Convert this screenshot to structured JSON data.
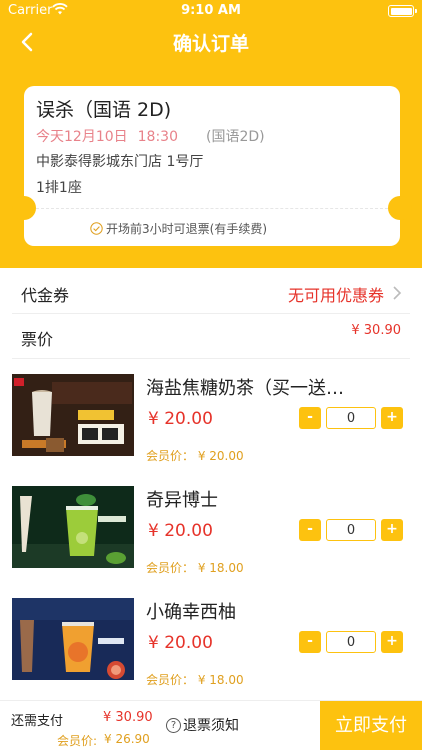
{
  "status_bar": {
    "carrier": "Carrier",
    "time": "9:10 AM"
  },
  "nav": {
    "title": "确认订单"
  },
  "ticket": {
    "movie": "误杀（国语 2D)",
    "date": "今天12月10日",
    "time": "18:30",
    "format": "(国语2D)",
    "cinema": "中影泰得影城东门店 1号厅",
    "seat": "1排1座",
    "refund_note": "开场前3小时可退票(有手续费)"
  },
  "voucher": {
    "label": "代金券",
    "status": "无可用优惠券"
  },
  "ticket_price": {
    "label": "票价",
    "value": "¥ 30.90"
  },
  "products": [
    {
      "name": "海盐焦糖奶茶（买一送一）",
      "price": "¥ 20.00",
      "member_price": "会员价： ¥ 20.00",
      "quantity": "0"
    },
    {
      "name": "奇异博士",
      "price": "¥ 20.00",
      "member_price": "会员价： ¥ 18.00",
      "quantity": "0"
    },
    {
      "name": "小确幸西柚",
      "price": "¥ 20.00",
      "member_price": "会员价： ¥ 18.00",
      "quantity": "0"
    }
  ],
  "stepper": {
    "minus": "-",
    "plus": "+"
  },
  "footer": {
    "due_label": "还需支付",
    "due_value": "¥ 30.90",
    "member_label": "会员价:",
    "member_value": "¥ 26.90",
    "notice_icon": "?",
    "notice": "退票须知",
    "pay_button": "立即支付"
  },
  "colors": {
    "accent": "#FDC20F",
    "price_red": "#E6332A",
    "member_gold": "#E0A020",
    "date_pink": "#E8828A"
  }
}
